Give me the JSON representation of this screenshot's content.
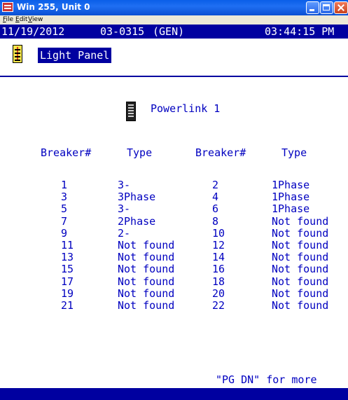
{
  "window": {
    "title": "Win 255, Unit 0"
  },
  "menu": [
    "File",
    "Edit",
    "View"
  ],
  "status": {
    "date": "11/19/2012",
    "code": "03-0315",
    "mode": "(GEN)",
    "time": "03:44:15 PM"
  },
  "screen_title": "Light Panel",
  "panel_name": "Powerlink 1",
  "table": {
    "headers": [
      "Breaker#",
      "Type",
      "Breaker#",
      "Type"
    ],
    "rows": [
      [
        "1",
        "3-",
        "2",
        "1Phase"
      ],
      [
        "3",
        "3Phase",
        "4",
        "1Phase"
      ],
      [
        "5",
        "3-",
        "6",
        "1Phase"
      ],
      [
        "7",
        "2Phase",
        "8",
        "Not found"
      ],
      [
        "9",
        "2-",
        "10",
        "Not found"
      ],
      [
        "11",
        "Not found",
        "12",
        "Not found"
      ],
      [
        "13",
        "Not found",
        "14",
        "Not found"
      ],
      [
        "15",
        "Not found",
        "16",
        "Not found"
      ],
      [
        "17",
        "Not found",
        "18",
        "Not found"
      ],
      [
        "19",
        "Not found",
        "20",
        "Not found"
      ],
      [
        "21",
        "Not found",
        "22",
        "Not found"
      ]
    ]
  },
  "footer_hint": "\"PG DN\" for more",
  "colors": {
    "terminal_bg": "#0000a0",
    "text": "#0000c0",
    "titlebar": "#0a5ee8"
  }
}
